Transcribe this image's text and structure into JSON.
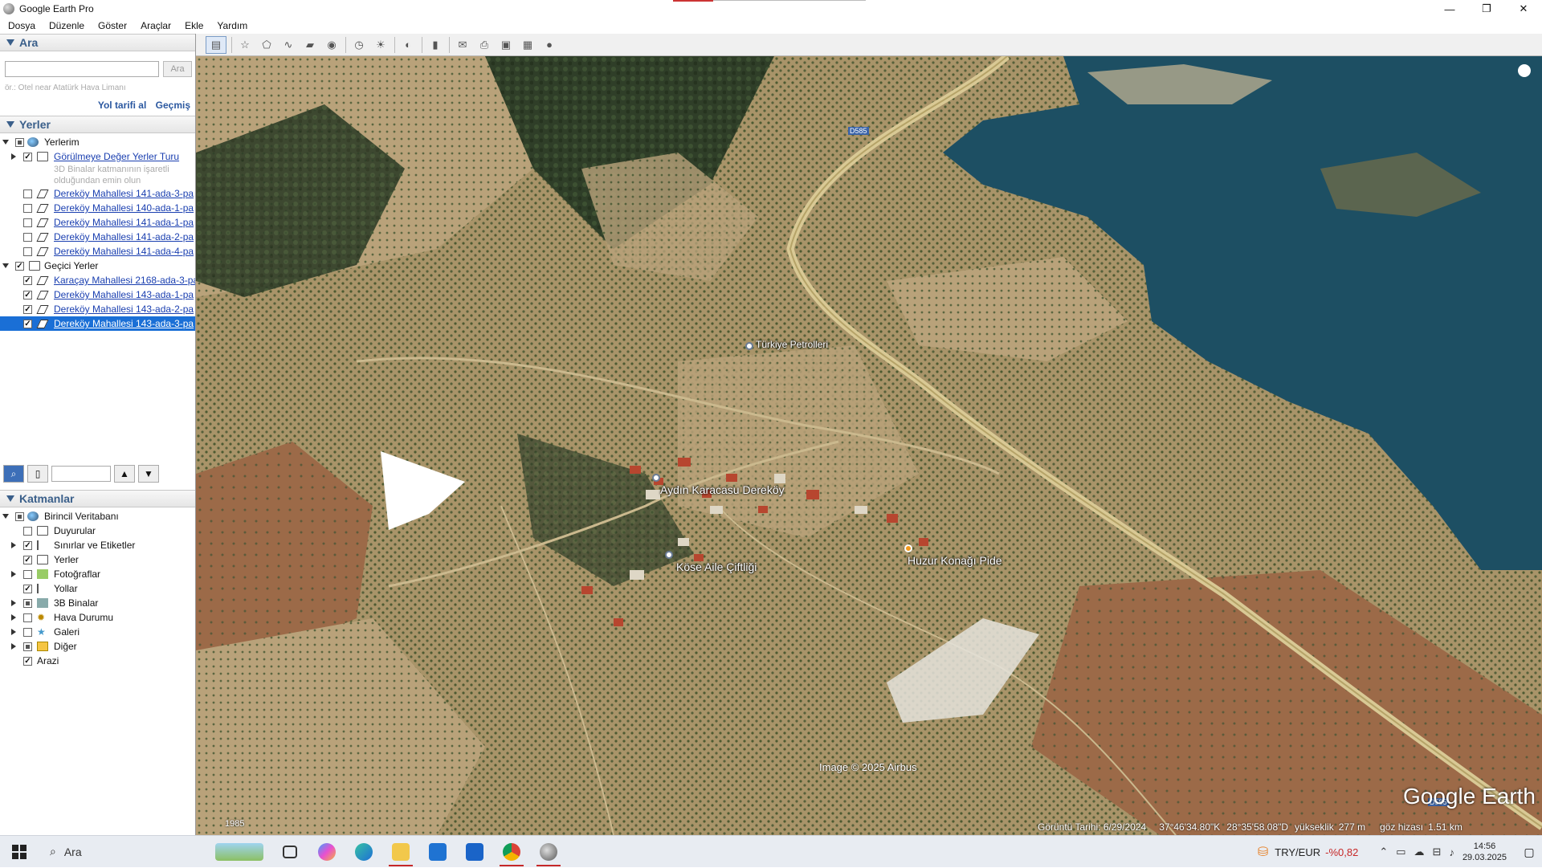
{
  "window": {
    "title": "Google Earth Pro",
    "controls": [
      "—",
      "❐",
      "✕"
    ]
  },
  "menu": [
    "Dosya",
    "Düzenle",
    "Göster",
    "Araçlar",
    "Ekle",
    "Yardım"
  ],
  "search": {
    "header": "Ara",
    "placeholder": "",
    "button": "Ara",
    "hint": "ör.: Otel near Atatürk Hava Limanı",
    "link_directions": "Yol tarifi al",
    "link_history": "Geçmiş"
  },
  "places": {
    "header": "Yerler",
    "items": [
      {
        "label": "Yerlerim"
      },
      {
        "label": "Görülmeye Değer Yerler Turu"
      },
      {
        "label": "3D Binalar katmanının işaretli"
      },
      {
        "label": "olduğundan emin olun"
      },
      {
        "label": "Dereköy Mahallesi 141-ada-3-pa"
      },
      {
        "label": "Dereköy Mahallesi 140-ada-1-pa"
      },
      {
        "label": "Dereköy Mahallesi 141-ada-1-pa"
      },
      {
        "label": "Dereköy Mahallesi 141-ada-2-pa"
      },
      {
        "label": "Dereköy Mahallesi 141-ada-4-pa"
      },
      {
        "label": "Geçici Yerler"
      },
      {
        "label": "Karaçay Mahallesi 2168-ada-3-pa"
      },
      {
        "label": "Dereköy Mahallesi 143-ada-1-pa"
      },
      {
        "label": "Dereköy Mahallesi 143-ada-2-pa"
      },
      {
        "label": "Dereköy Mahallesi 143-ada-3-pa"
      }
    ]
  },
  "layers": {
    "header": "Katmanlar",
    "items": [
      {
        "label": "Birincil Veritabanı"
      },
      {
        "label": "Duyurular"
      },
      {
        "label": "Sınırlar ve Etiketler"
      },
      {
        "label": "Yerler"
      },
      {
        "label": "Fotoğraflar"
      },
      {
        "label": "Yollar"
      },
      {
        "label": "3B Binalar"
      },
      {
        "label": "Hava Durumu"
      },
      {
        "label": "Galeri"
      },
      {
        "label": "Diğer"
      },
      {
        "label": "Arazi"
      }
    ]
  },
  "map": {
    "labels": {
      "petrol": "Türkiye Petrolleri",
      "village": "Aydın Karacasu Dereköy",
      "farm": "Köse Aile Çiftliği",
      "restaurant": "Huzur Konağı Pide",
      "road_d585_a": "D585",
      "road_d585_b": "D585"
    },
    "imagery_credit": "Image © 2025 Airbus",
    "logo": "Google Earth",
    "year": "1985",
    "status": {
      "date": "Görüntü Tarihi: 6/29/2024",
      "lat": "37°46'34.80\"K",
      "lon": "28°35'58.08\"D",
      "elev_label": "yükseklik",
      "elev": "277 m",
      "eye_label": "göz hizası",
      "eye": "1.51 km"
    }
  },
  "taskbar": {
    "search": "Ara",
    "currency": "TRY/EUR",
    "change": "-%0,82",
    "time": "14:56",
    "date": "29.03.2025"
  },
  "colors": {
    "accent": "#1a6fd6",
    "link": "#1a3fb0",
    "section_header": "#3a5f8a",
    "water": "#1d4f63",
    "negative": "#c62828"
  }
}
